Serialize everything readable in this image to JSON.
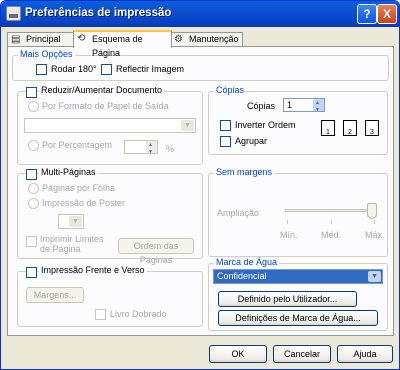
{
  "window": {
    "title": "Preferências de impressão",
    "help": "?",
    "close": "X"
  },
  "tabs": [
    "Principal",
    "Esquema de Página",
    "Manutenção"
  ],
  "mais_opcoes": {
    "label": "Mais Opções",
    "rodar": "Rodar 180°",
    "reflectir": "Reflectir Imagem"
  },
  "reduzir": {
    "label": "Reduzir/Aumentar Documento",
    "por_formato": "Por Formato de Papel de Saída",
    "por_percentagem": "Por Percentagem",
    "percent_sign": "%"
  },
  "multi": {
    "label": "Multi-Páginas",
    "paginas_folha": "Páginas por Folha",
    "impressao_poster": "Impressão de Poster",
    "imprimir_limites": "Imprimir Limites",
    "de_pagina": "de Página",
    "ordem_button": "Ordem das Páginas"
  },
  "frente_verso": {
    "label": "Impressão Frente e Verso",
    "margens_button": "Margens...",
    "livro": "Livro Dobrado"
  },
  "copias": {
    "label": "Cópias",
    "copias_label": "Cópias",
    "copias_value": "1",
    "inverter": "Inverter Ordem",
    "agrupar": "Agrupar",
    "collate_pages": [
      "1",
      "2",
      "3"
    ]
  },
  "sem_margens": {
    "label": "Sem margens",
    "ampliacao": "Ampliação",
    "ticks": [
      "Mín.",
      "Méd.",
      "Máx."
    ]
  },
  "marca_agua": {
    "label": "Marca de Água",
    "selected": "Confidencial",
    "definido_button": "Definido pelo Utilizador...",
    "definicoes_button": "Definições de Marca de Água..."
  },
  "footer": {
    "ok": "OK",
    "cancelar": "Cancelar",
    "ajuda": "Ajuda"
  }
}
